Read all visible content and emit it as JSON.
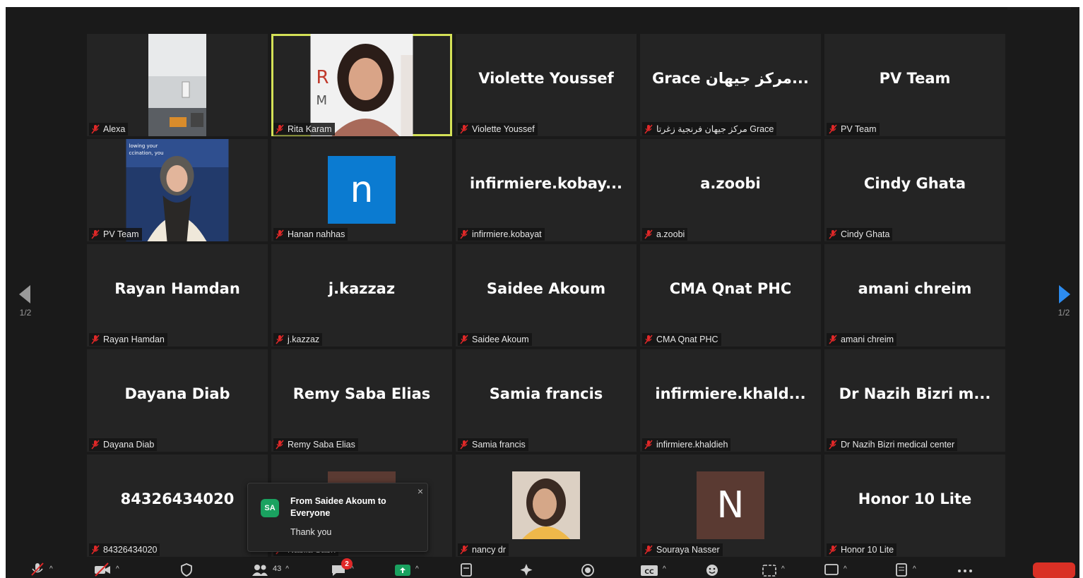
{
  "grid": {
    "tiles": [
      {
        "display": "",
        "label": "Alexa",
        "type": "photo",
        "photo": "alexa"
      },
      {
        "display": "",
        "label": "Rita Karam",
        "type": "photo",
        "photo": "rita",
        "active": true
      },
      {
        "display": "Violette Youssef",
        "label": "Violette Youssef",
        "type": "name"
      },
      {
        "display": "Grace مركز جيهان...",
        "label": "مركز جيهان فرنجية زغرتا Grace",
        "type": "name"
      },
      {
        "display": "PV Team",
        "label": "PV Team",
        "type": "name"
      },
      {
        "display": "",
        "label": "PV Team",
        "type": "photo",
        "photo": "pvteam"
      },
      {
        "display": "n",
        "label": "Hanan nahhas",
        "type": "avatar",
        "avatar_color": "#0b7bd1"
      },
      {
        "display": "infirmiere.kobay...",
        "label": "infirmiere.kobayat",
        "type": "name"
      },
      {
        "display": "a.zoobi",
        "label": "a.zoobi",
        "type": "name"
      },
      {
        "display": "Cindy Ghata",
        "label": "Cindy Ghata",
        "type": "name"
      },
      {
        "display": "Rayan Hamdan",
        "label": "Rayan Hamdan",
        "type": "name"
      },
      {
        "display": "j.kazzaz",
        "label": "j.kazzaz",
        "type": "name"
      },
      {
        "display": "Saidee Akoum",
        "label": "Saidee Akoum",
        "type": "name"
      },
      {
        "display": "CMA Qnat PHC",
        "label": "CMA Qnat PHC",
        "type": "name"
      },
      {
        "display": "amani chreim",
        "label": "amani chreim",
        "type": "name"
      },
      {
        "display": "Dayana Diab",
        "label": "Dayana Diab",
        "type": "name"
      },
      {
        "display": "Remy Saba Elias",
        "label": "Remy Saba Elias",
        "type": "name"
      },
      {
        "display": "Samia francis",
        "label": "Samia francis",
        "type": "name"
      },
      {
        "display": "infirmiere.khald...",
        "label": "infirmiere.khaldieh",
        "type": "name"
      },
      {
        "display": "Dr Nazih Bizri m...",
        "label": "Dr Nazih Bizri medical center",
        "type": "name"
      },
      {
        "display": "84326434020",
        "label": "84326434020",
        "type": "name"
      },
      {
        "display": "",
        "label": "Nabila Sabri",
        "type": "avatar",
        "avatar_color": "#5a3a32"
      },
      {
        "display": "",
        "label": "nancy dr",
        "type": "photo",
        "photo": "nancy"
      },
      {
        "display": "N",
        "label": "Souraya Nasser",
        "type": "avatar",
        "avatar_color": "#5a3a32"
      },
      {
        "display": "Honor 10 Lite",
        "label": "Honor 10 Lite",
        "type": "name"
      }
    ]
  },
  "nav": {
    "left_page": "1/2",
    "right_page": "1/2"
  },
  "toast": {
    "initials": "SA",
    "title": "From Saidee Akoum to Everyone",
    "message": "Thank you",
    "close": "×"
  },
  "toolbar": {
    "participants_count": "43",
    "chat_badge": "2",
    "icons": [
      "mic-muted-icon",
      "video-off-icon",
      "security-icon",
      "participants-icon",
      "chat-icon",
      "share-screen-icon",
      "notes-icon",
      "apps-icon",
      "record-icon",
      "captions-icon",
      "reactions-icon",
      "rooms-icon",
      "whiteboard-icon",
      "summary-icon",
      "more-icon"
    ],
    "accent_color": "#1aa260",
    "end_color": "#d93025"
  }
}
